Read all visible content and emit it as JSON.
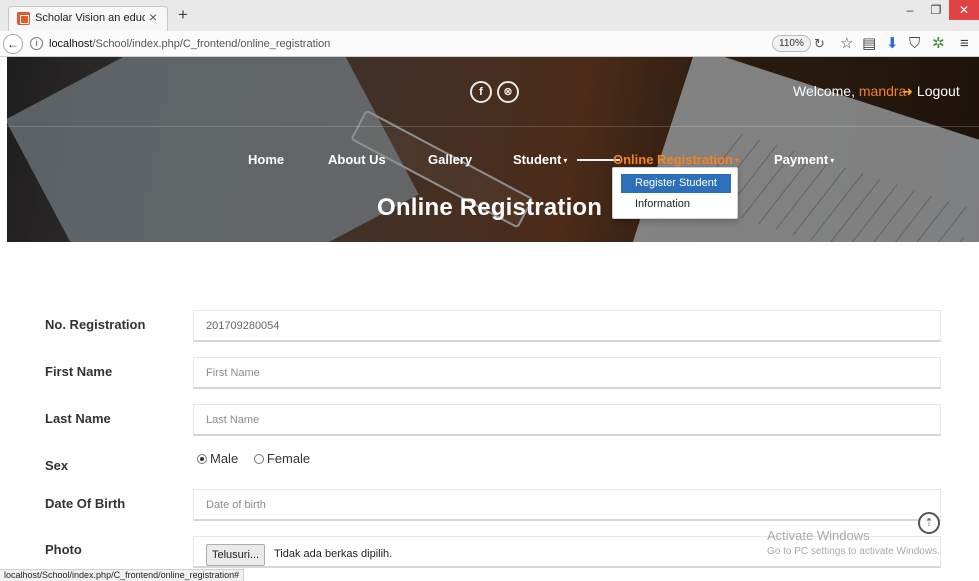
{
  "browser": {
    "tab_title": "Scholar Vision an education",
    "tab_close": "×",
    "new_tab": "+",
    "url_host": "localhost",
    "url_path": "/School/index.php/C_frontend/online_registration",
    "zoom": "110%",
    "status_url": "localhost/School/index.php/C_frontend/online_registration#"
  },
  "header": {
    "social": [
      {
        "name": "facebook-icon",
        "glyph": "f"
      },
      {
        "name": "dribbble-icon",
        "glyph": "⊗"
      }
    ],
    "welcome_prefix": "Welcome,",
    "username": "mandra",
    "logout_label": "Logout",
    "nav": [
      {
        "label": "Home"
      },
      {
        "label": "About Us"
      },
      {
        "label": "Gallery"
      },
      {
        "label": "Student"
      },
      {
        "label": "Online Registration"
      },
      {
        "label": "Payment"
      }
    ],
    "caret": "▾",
    "page_title": "Online Registration",
    "dropdown": [
      {
        "label": "Register Student"
      },
      {
        "label": "Information"
      }
    ]
  },
  "form": {
    "registration_label": "No. Registration",
    "registration_value": "201709280054",
    "first_name_label": "First Name",
    "first_name_placeholder": "First Name",
    "last_name_label": "Last Name",
    "last_name_placeholder": "Last Name",
    "sex_label": "Sex",
    "sex_options": [
      {
        "label": "Male",
        "checked": true
      },
      {
        "label": "Female",
        "checked": false
      }
    ],
    "dob_label": "Date Of Birth",
    "dob_placeholder": "Date of birth",
    "photo_label": "Photo",
    "file_button": "Telusuri...",
    "file_status": "Tidak ada berkas dipilih."
  },
  "overlay": {
    "activate_title": "Activate Windows",
    "activate_sub": "Go to PC settings to activate Windows.",
    "scroll_up": "⇡"
  },
  "colors": {
    "accent": "#f58220",
    "dropdown_active": "#2d6fb8",
    "windows_close": "#e04343"
  }
}
